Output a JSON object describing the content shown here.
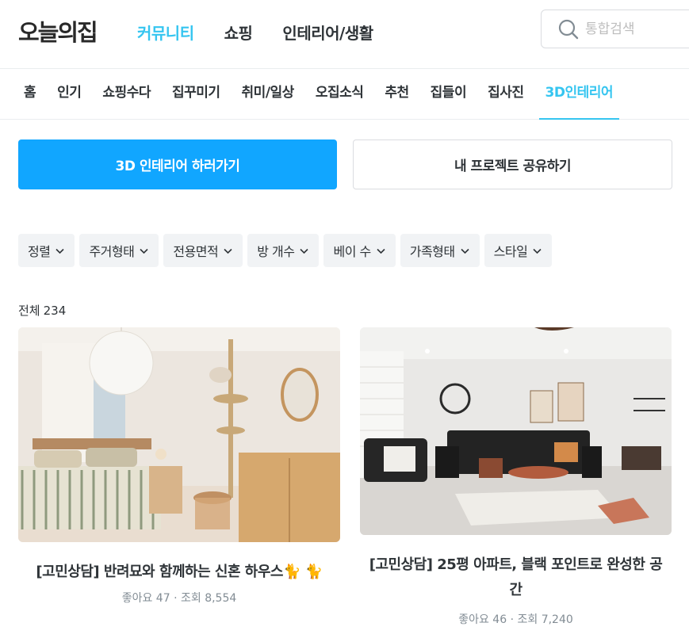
{
  "header": {
    "logo": "오늘의집",
    "nav": [
      {
        "label": "커뮤니티",
        "active": true
      },
      {
        "label": "쇼핑",
        "active": false
      },
      {
        "label": "인테리어/생활",
        "active": false
      }
    ],
    "search": {
      "placeholder": "통합검색",
      "icon": "search-icon"
    }
  },
  "subnav": {
    "items": [
      {
        "label": "홈",
        "active": false
      },
      {
        "label": "인기",
        "active": false
      },
      {
        "label": "쇼핑수다",
        "active": false
      },
      {
        "label": "집꾸미기",
        "active": false
      },
      {
        "label": "취미/일상",
        "active": false
      },
      {
        "label": "오집소식",
        "active": false
      },
      {
        "label": "추천",
        "active": false
      },
      {
        "label": "집들이",
        "active": false
      },
      {
        "label": "집사진",
        "active": false
      },
      {
        "label": "3D인테리어",
        "active": true
      }
    ]
  },
  "actions": {
    "primary_label": "3D 인테리어 하러가기",
    "secondary_label": "내 프로젝트 공유하기"
  },
  "filters": [
    {
      "label": "정렬"
    },
    {
      "label": "주거형태"
    },
    {
      "label": "전용면적"
    },
    {
      "label": "방 개수"
    },
    {
      "label": "베이 수"
    },
    {
      "label": "가족형태"
    },
    {
      "label": "스타일"
    }
  ],
  "results": {
    "total_label": "전체",
    "total_count": "234"
  },
  "cards": [
    {
      "title": "[고민상담] 반려묘와 함께하는 신혼 하우스🐈 🐈",
      "likes_label": "좋아요 47",
      "views_label": "조회 8,554"
    },
    {
      "title": "[고민상담] 25평 아파트, 블랙 포인트로 완성한 공간",
      "likes_label": "좋아요 46",
      "views_label": "조회 7,240"
    }
  ],
  "colors": {
    "accent": "#35c5f0",
    "primary_button": "#11a6ff",
    "chip_bg": "#f1f3f5",
    "meta_text": "#828c94"
  }
}
